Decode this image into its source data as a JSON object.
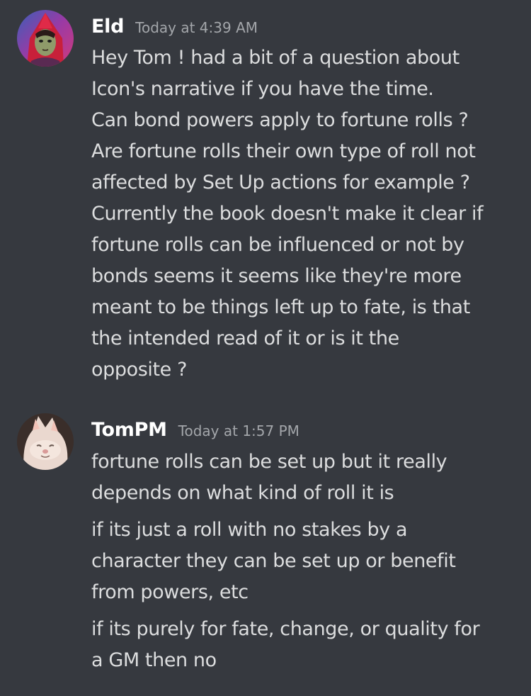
{
  "messages": [
    {
      "author": "Eld",
      "timestamp": "Today at 4:39 AM",
      "avatar_icon": "hooded-figure-avatar",
      "paragraphs": [
        [
          "Hey Tom ! had a bit of a question about",
          "Icon's narrative if you have the time.",
          "Can bond powers apply to fortune rolls ?",
          "Are fortune rolls their own type of roll not",
          "affected by Set Up actions for example ?",
          "Currently the book doesn't make it clear if",
          "fortune rolls can be influenced or not by",
          "bonds seems it seems like they're more",
          "meant to be things left up to fate, is that",
          "the intended read of it or is it the",
          "opposite ?"
        ]
      ]
    },
    {
      "author": "TomPM",
      "timestamp": "Today at 1:57 PM",
      "avatar_icon": "cat-face-avatar",
      "paragraphs": [
        [
          "fortune rolls can be set up but it really",
          "depends on what kind of roll it is"
        ],
        [
          "if its just a roll with no stakes by a",
          "character they can be set up or benefit",
          "from powers, etc"
        ],
        [
          "if its purely for fate, change, or quality for",
          "a GM then no"
        ]
      ]
    }
  ],
  "colors": {
    "background": "#36393f",
    "username": "#ffffff",
    "timestamp": "#a3a6aa",
    "message_text": "#dcddde"
  }
}
